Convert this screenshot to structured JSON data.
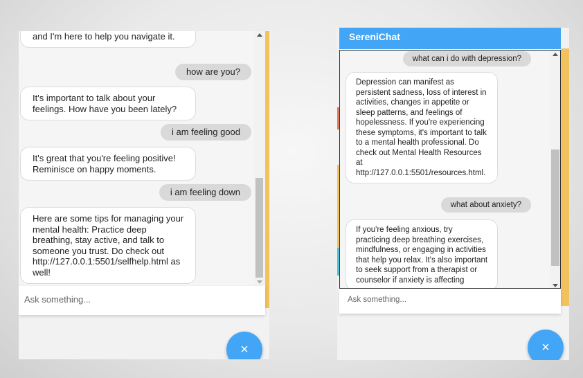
{
  "left_chat": {
    "messages": [
      {
        "role": "bot",
        "text": "have. Your well-being is important, and I'm here to help you navigate it."
      },
      {
        "role": "user",
        "text": "how are you?"
      },
      {
        "role": "bot",
        "text": "It's important to talk about your feelings. How have you been lately?"
      },
      {
        "role": "user",
        "text": "i am feeling good"
      },
      {
        "role": "bot",
        "text": "It's great that you're feeling positive! Reminisce on happy moments."
      },
      {
        "role": "user",
        "text": "i am feeling down"
      },
      {
        "role": "bot",
        "text": "Here are some tips for managing your mental health: Practice deep breathing, stay active, and talk to someone you trust. Do check out http://127.0.0.1:5501/selfhelp.html as well!"
      }
    ],
    "input_placeholder": "Ask something...",
    "close_icon": "×"
  },
  "right_chat": {
    "title": "SereniChat",
    "messages": [
      {
        "role": "user",
        "text": "what can i do with depression?"
      },
      {
        "role": "bot",
        "text": "Depression can manifest as persistent sadness, loss of interest in activities, changes in appetite or sleep patterns, and feelings of hopelessness. If you're experiencing these symptoms, it's important to talk to a mental health professional. Do check out Mental Health Resources at http://127.0.0.1:5501/resources.html."
      },
      {
        "role": "user",
        "text": "what about anxiety?"
      },
      {
        "role": "bot",
        "text": "If you're feeling anxious, try practicing deep breathing exercises, mindfulness, or engaging in activities that help you relax. It's also important to seek support from a therapist or counselor if anxiety is affecting"
      }
    ],
    "input_placeholder": "Ask something...",
    "close_icon": "×"
  },
  "colors": {
    "accent_blue": "#42a5f5",
    "accent_yellow": "#f1c35f",
    "user_bubble": "#d9d9d9"
  }
}
